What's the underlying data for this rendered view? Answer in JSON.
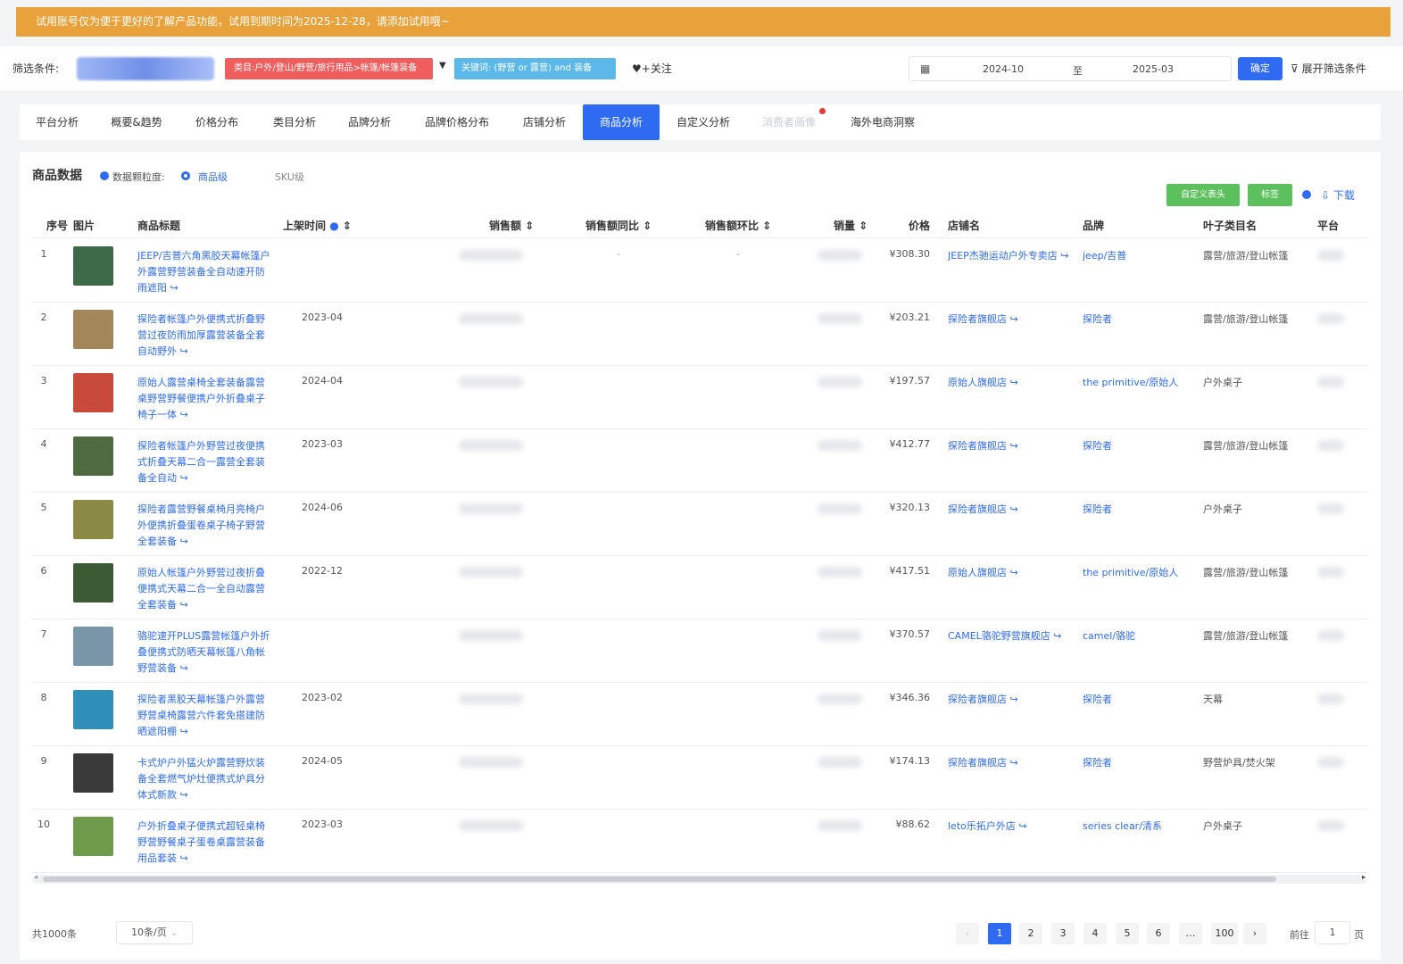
{
  "banner": {
    "text": "试用账号仅为便于更好的了解产品功能，试用到期时间为2025-12-28，请添加试用哦~"
  },
  "filter": {
    "label": "筛选条件:",
    "tag_red": "类目:户外/登山/野营/旅行用品>帐篷/帐篷装备",
    "tag_blue": "关键词: (野营 or 露营) and 装备",
    "follow": "+关注",
    "date_start": "2024-10",
    "date_sep": "至",
    "date_end": "2025-03",
    "confirm": "确定",
    "expand": "展开筛选条件"
  },
  "tabs": [
    "平台分析",
    "概要&趋势",
    "价格分布",
    "类目分析",
    "品牌分析",
    "品牌价格分布",
    "店铺分析",
    "商品分析",
    "自定义分析",
    "消费者画像",
    "海外电商洞察"
  ],
  "active_tab": "商品分析",
  "section": {
    "title": "商品数据",
    "granularity_label": "数据颗粒度:",
    "level_goods": "商品级",
    "level_sku": "SKU级",
    "custom_header_btn": "自定义表头",
    "bookmark_btn": "标签",
    "download": "下载"
  },
  "columns": [
    "序号",
    "图片",
    "商品标题",
    "上架时间",
    "销售额",
    "销售额同比",
    "销售额环比",
    "销量",
    "价格",
    "店铺名",
    "品牌",
    "叶子类目名",
    "平台"
  ],
  "rows": [
    {
      "idx": "1",
      "title": "JEEP/吉普六角黑胶天幕帐篷户外露营野营装备全自动速开防雨遮阳",
      "date": "",
      "yoy": "-",
      "mom": "-",
      "price": "¥308.30",
      "shop": "JEEP杰驰运动户外专卖店",
      "brand": "jeep/吉普",
      "category": "露营/旅游/登山帐篷",
      "img_color": "#3d6b4a"
    },
    {
      "idx": "2",
      "title": "探险者帐篷户外便携式折叠野营过夜防雨加厚露营装备全套自动野外",
      "date": "2023-04",
      "yoy": "",
      "mom": "",
      "price": "¥203.21",
      "shop": "探险者旗舰店",
      "brand": "探险者",
      "category": "露营/旅游/登山帐篷",
      "img_color": "#a3865a"
    },
    {
      "idx": "3",
      "title": "原始人露营桌椅全套装备露营桌野营野餐便携户外折叠桌子椅子一体",
      "date": "2024-04",
      "yoy": "",
      "mom": "",
      "price": "¥197.57",
      "shop": "原始人旗舰店",
      "brand": "the primitive/原始人",
      "category": "户外桌子",
      "img_color": "#c74a3b"
    },
    {
      "idx": "4",
      "title": "探险者帐篷户外野营过夜便携式折叠天幕二合一露营全套装备全自动",
      "date": "2023-03",
      "yoy": "",
      "mom": "",
      "price": "¥412.77",
      "shop": "探险者旗舰店",
      "brand": "探险者",
      "category": "露营/旅游/登山帐篷",
      "img_color": "#4f6a3e"
    },
    {
      "idx": "5",
      "title": "探险者露营野餐桌椅月亮椅户外便携折叠蛋卷桌子椅子野营全套装备",
      "date": "2024-06",
      "yoy": "",
      "mom": "",
      "price": "¥320.13",
      "shop": "探险者旗舰店",
      "brand": "探险者",
      "category": "户外桌子",
      "img_color": "#8a8a45"
    },
    {
      "idx": "6",
      "title": "原始人帐篷户外野营过夜折叠便携式天幕二合一全自动露营全套装备",
      "date": "2022-12",
      "yoy": "",
      "mom": "",
      "price": "¥417.51",
      "shop": "原始人旗舰店",
      "brand": "the primitive/原始人",
      "category": "露营/旅游/登山帐篷",
      "img_color": "#3c5a34"
    },
    {
      "idx": "7",
      "title": "骆驼速开PLUS露营帐篷户外折叠便携式防晒天幕帐篷八角帐野营装备",
      "date": "",
      "yoy": "",
      "mom": "",
      "price": "¥370.57",
      "shop": "CAMEL骆驼野营旗舰店",
      "brand": "camel/骆驼",
      "category": "露营/旅游/登山帐篷",
      "img_color": "#7896a8"
    },
    {
      "idx": "8",
      "title": "探险者黑胶天幕帐篷户外露营野营桌椅露营六件套免搭建防晒遮阳棚",
      "date": "2023-02",
      "yoy": "",
      "mom": "",
      "price": "¥346.36",
      "shop": "探险者旗舰店",
      "brand": "探险者",
      "category": "天幕",
      "img_color": "#2f8fb8"
    },
    {
      "idx": "9",
      "title": "卡式炉户外猛火炉露营野炊装备全套燃气炉灶便携式炉具分体式新款",
      "date": "2024-05",
      "yoy": "",
      "mom": "",
      "price": "¥174.13",
      "shop": "探险者旗舰店",
      "brand": "探险者",
      "category": "野营炉具/焚火架",
      "img_color": "#3a3a3a"
    },
    {
      "idx": "10",
      "title": "户外折叠桌子便携式超轻桌椅野营野餐桌子蛋卷桌露营装备用品套装",
      "date": "2023-03",
      "yoy": "",
      "mom": "",
      "price": "¥88.62",
      "shop": "leto乐拓户外店",
      "brand": "series clear/清系",
      "category": "户外桌子",
      "img_color": "#6e9a4a"
    }
  ],
  "pagination": {
    "total": "共1000条",
    "page_size": "10条/页",
    "pages": [
      "1",
      "2",
      "3",
      "4",
      "5",
      "6",
      "…",
      "100"
    ],
    "goto_label": "前往",
    "goto_value": "1",
    "unit": "页"
  }
}
